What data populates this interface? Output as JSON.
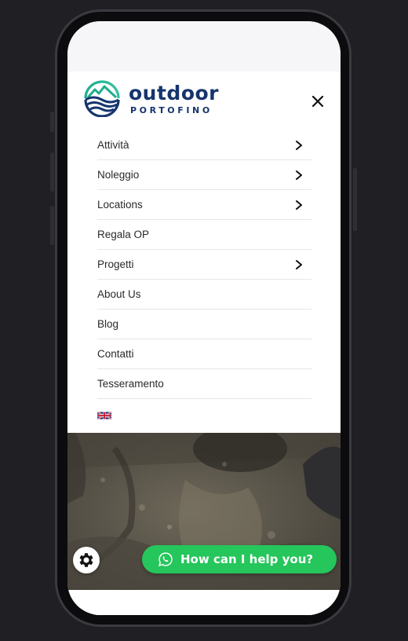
{
  "brand": {
    "name": "outdoor",
    "subtitle": "PORTOFINO",
    "primary_color": "#16356e",
    "accent_color": "#1fae8e"
  },
  "menu": {
    "close_icon": "close-icon",
    "items": [
      {
        "label": "Attività",
        "has_submenu": true
      },
      {
        "label": "Noleggio",
        "has_submenu": true
      },
      {
        "label": "Locations",
        "has_submenu": true
      },
      {
        "label": "Regala OP",
        "has_submenu": false
      },
      {
        "label": "Progetti",
        "has_submenu": true
      },
      {
        "label": "About Us",
        "has_submenu": false
      },
      {
        "label": "Blog",
        "has_submenu": false
      },
      {
        "label": "Contatti",
        "has_submenu": false
      },
      {
        "label": "Tesseramento",
        "has_submenu": false
      }
    ],
    "language_icon": "uk-flag-icon"
  },
  "widgets": {
    "settings_icon": "gear-icon",
    "whatsapp": {
      "label": "How can I help you?",
      "icon": "whatsapp-icon",
      "color": "#25c65b"
    }
  }
}
